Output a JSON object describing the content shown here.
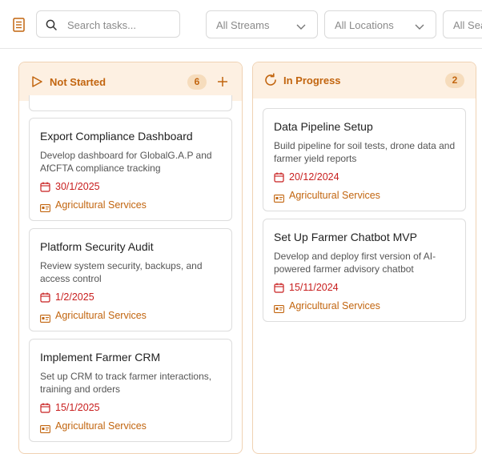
{
  "toolbar": {
    "doc_icon": "document-icon",
    "search": {
      "icon": "search-icon",
      "placeholder": "Search tasks..."
    },
    "filters": [
      {
        "value": "All Streams",
        "icon": "chevron-down-icon"
      },
      {
        "value": "All Locations",
        "icon": "chevron-down-icon"
      },
      {
        "value": "All Sea",
        "icon": "chevron-down-icon"
      }
    ]
  },
  "columns": [
    {
      "title": "Not Started",
      "icon": "play-outline-icon",
      "count": "6",
      "add_icon": "plus-icon",
      "cards": [
        {
          "title": "Export Compliance Dashboard",
          "description": "Develop dashboard for GlobalG.A.P and AfCFTA compliance tracking",
          "date": "30/1/2025",
          "tag": "Agricultural Services"
        },
        {
          "title": "Platform Security Audit",
          "description": "Review system security, backups, and access control",
          "date": "1/2/2025",
          "tag": "Agricultural Services"
        },
        {
          "title": "Implement Farmer CRM",
          "description": "Set up CRM to track farmer interactions, training and orders",
          "date": "15/1/2025",
          "tag": "Agricultural Services"
        }
      ]
    },
    {
      "title": "In Progress",
      "icon": "refresh-icon",
      "count": "2",
      "cards": [
        {
          "title": "Data Pipeline Setup",
          "description": "Build pipeline for soil tests, drone data and farmer yield reports",
          "date": "20/12/2024",
          "tag": "Agricultural Services"
        },
        {
          "title": "Set Up Farmer Chatbot MVP",
          "description": "Develop and deploy first version of AI-powered farmer advisory chatbot",
          "date": "15/11/2024",
          "tag": "Agricultural Services"
        }
      ]
    }
  ],
  "colors": {
    "accent": "#c2650f",
    "header_bg": "#fdf0e2",
    "column_border": "#f0d2b3",
    "date_red": "#c81e1e"
  }
}
